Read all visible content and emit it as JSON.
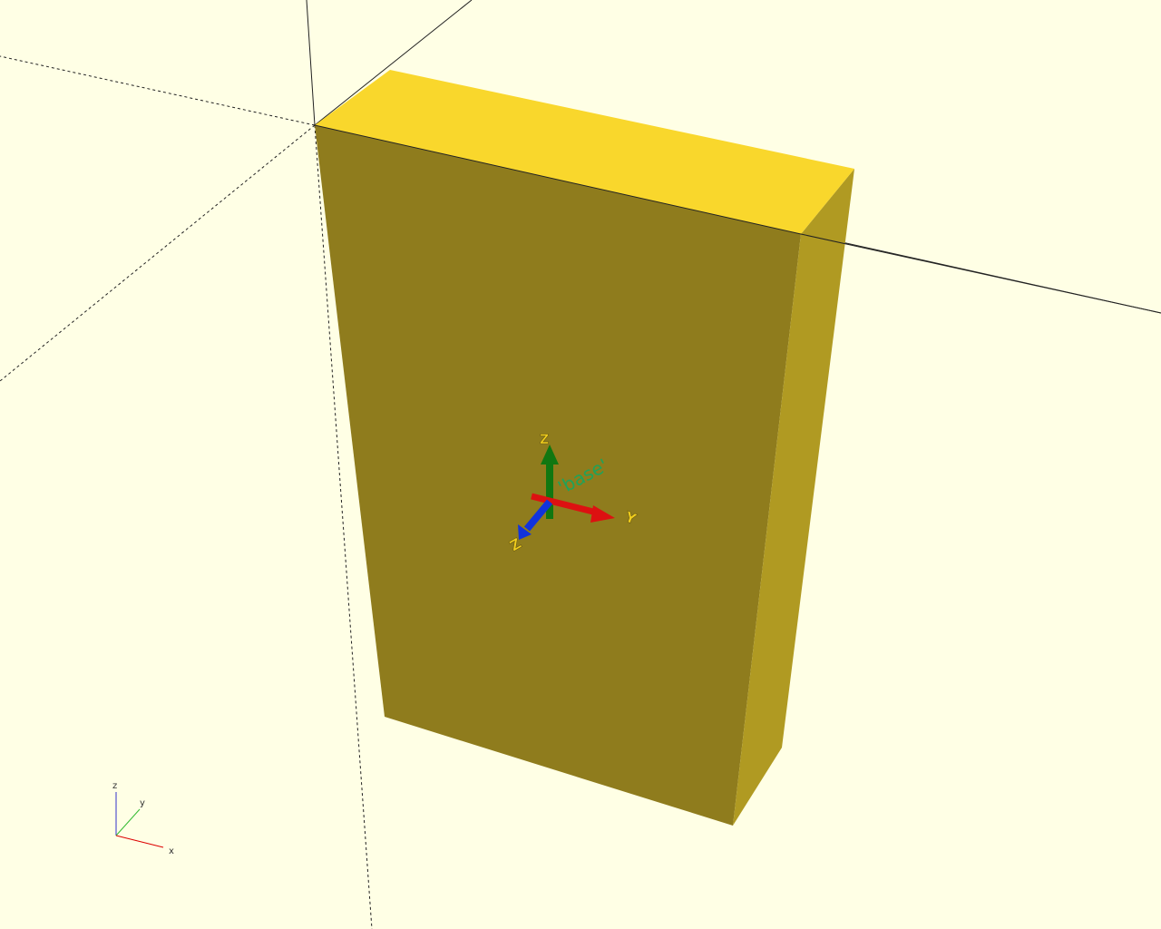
{
  "viewport": {
    "background": "#ffffe5"
  },
  "model": {
    "top_color": "#f9d72c",
    "front_color": "#8f7c1d",
    "side_color": "#b09a22"
  },
  "anchor": {
    "label": "'base'",
    "label_color": "#1fa35a",
    "arrow_x_color": "#dd1111",
    "arrow_y_color": "#117711",
    "arrow_z_color": "#1133dd",
    "tip_label_x": "Y",
    "tip_label_y": "Z",
    "tip_label_z": "Z",
    "tip_color": "#f2cf1d"
  },
  "axes_indicator": {
    "x_label": "x",
    "y_label": "y",
    "z_label": "z",
    "x_color": "#dd0000",
    "y_color": "#33bb33",
    "z_color": "#3333cc"
  }
}
